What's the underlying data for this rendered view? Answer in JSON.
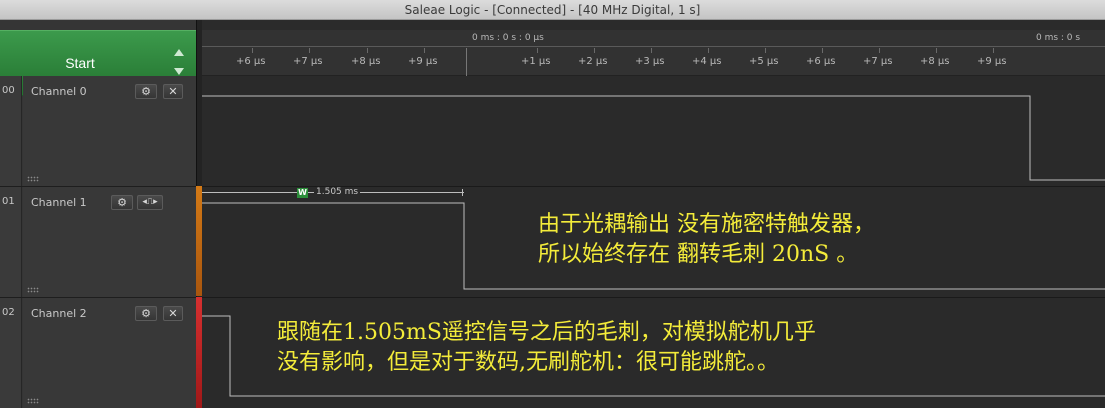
{
  "window": {
    "title": "Saleae Logic - [Connected] - [40 MHz Digital, 1 s]"
  },
  "header": {
    "start_label": "Start"
  },
  "timeline": {
    "marker_label": "0 ms : 0 s : 0 μs",
    "marker_label_right": "0 ms : 0 s",
    "ticks_left": [
      "+6 μs",
      "+7 μs",
      "+8 μs",
      "+9 μs"
    ],
    "ticks_right": [
      "+1 μs",
      "+2 μs",
      "+3 μs",
      "+4 μs",
      "+5 μs",
      "+6 μs",
      "+7 μs",
      "+8 μs",
      "+9 μs"
    ]
  },
  "channels": [
    {
      "num": "00",
      "name": "Channel 0",
      "gear": "⚙",
      "close": "✕"
    },
    {
      "num": "01",
      "name": "Channel 1",
      "gear": "⚙",
      "close": "✕",
      "trigger": "◂⎍▸"
    },
    {
      "num": "02",
      "name": "Channel 2",
      "gear": "⚙",
      "close": "✕"
    }
  ],
  "measurement": {
    "badge": "W",
    "value": "1.505 ms"
  },
  "annotations": {
    "line1": "由于光耦输出 没有施密特触发器，",
    "line2": "所以始终存在 翻转毛刺 20nS 。",
    "line3": "跟随在1.505mS遥控信号之后的毛刺，对模拟舵机几乎",
    "line4": "没有影响，但是对于数码,无刷舵机：很可能跳舵。。"
  },
  "colors": {
    "header_green": "#2e8a3c",
    "signal": "#bdbdbd",
    "annotation": "#f4ec3a"
  }
}
